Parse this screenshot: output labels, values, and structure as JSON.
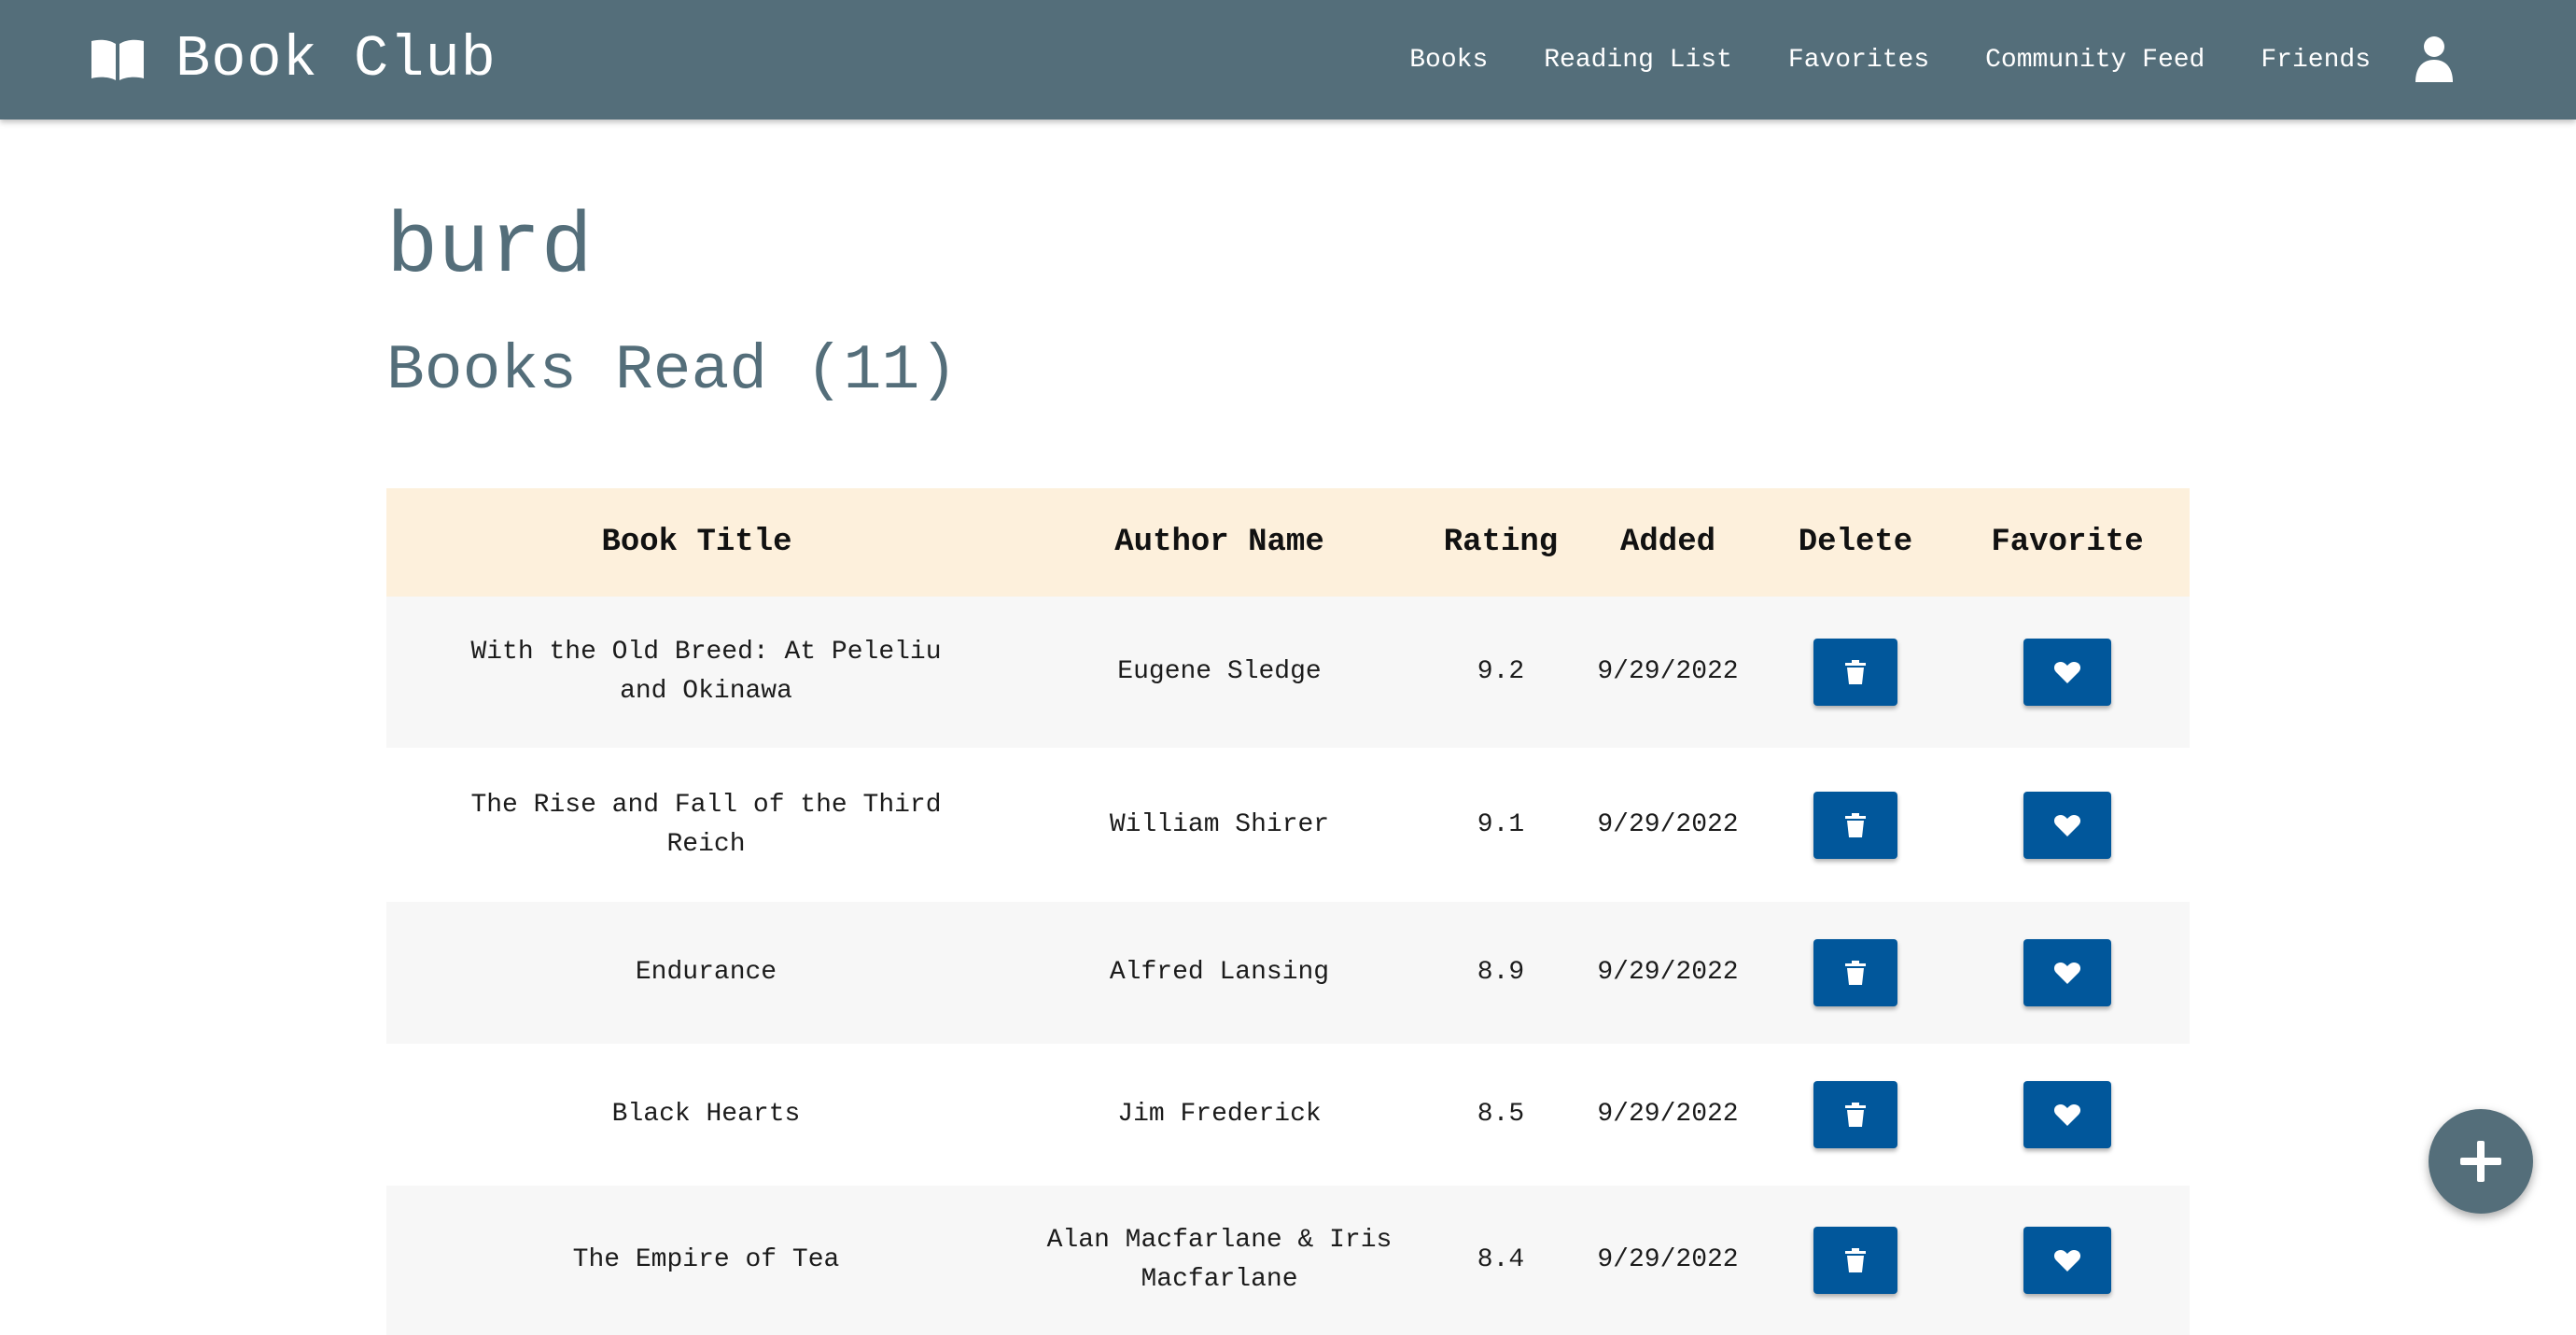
{
  "app": {
    "brand_icon": "open-book-icon",
    "title": "Book Club"
  },
  "nav": {
    "items": [
      {
        "label": "Books"
      },
      {
        "label": "Reading List"
      },
      {
        "label": "Favorites"
      },
      {
        "label": "Community Feed"
      },
      {
        "label": "Friends"
      }
    ],
    "user_icon": "user-icon"
  },
  "profile": {
    "username": "burd",
    "section_title": "Books Read (11)"
  },
  "table": {
    "headers": [
      "Book Title",
      "Author Name",
      "Rating",
      "Added",
      "Delete",
      "Favorite"
    ],
    "rows": [
      {
        "title": "With the Old Breed: At Peleliu and Okinawa",
        "author": "Eugene Sledge",
        "rating": "9.2",
        "added": "9/29/2022"
      },
      {
        "title": "The Rise and Fall of the Third Reich",
        "author": "William Shirer",
        "rating": "9.1",
        "added": "9/29/2022"
      },
      {
        "title": "Endurance",
        "author": "Alfred Lansing",
        "rating": "8.9",
        "added": "9/29/2022"
      },
      {
        "title": "Black Hearts",
        "author": "Jim Frederick",
        "rating": "8.5",
        "added": "9/29/2022"
      },
      {
        "title": "The Empire of Tea",
        "author": "Alan Macfarlane & Iris Macfarlane",
        "rating": "8.4",
        "added": "9/29/2022"
      }
    ],
    "delete_icon": "trash-icon",
    "favorite_icon": "heart-icon"
  },
  "fab": {
    "icon": "plus-icon"
  },
  "colors": {
    "navbar": "#546e7a",
    "header_row": "#fdf0dc",
    "button": "#01579b",
    "row_alt": "#f7f7f7"
  }
}
